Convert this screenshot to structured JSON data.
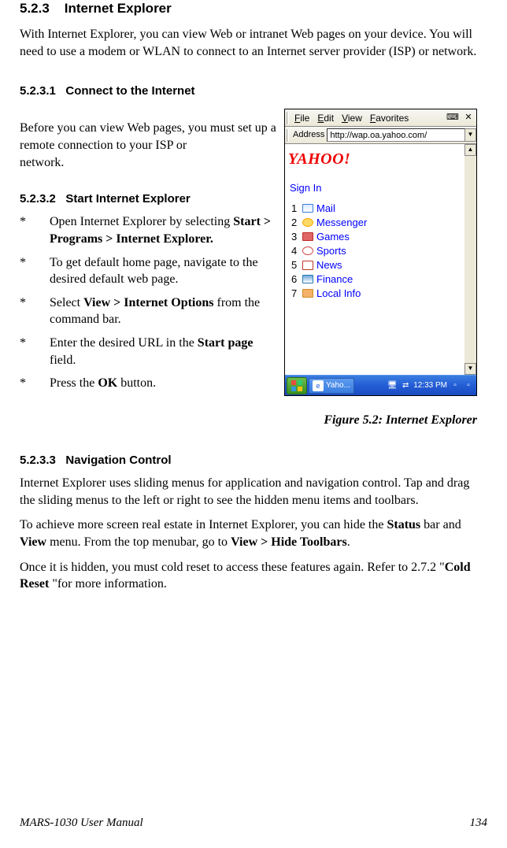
{
  "section": {
    "number": "5.2.3",
    "title": "Internet Explorer",
    "intro": "With Internet Explorer, you can view Web or intranet Web pages on your device. You will need to use a modem or WLAN to connect to an Internet server provider (ISP) or network."
  },
  "sub1": {
    "number": "5.2.3.1",
    "title": "Connect to the Internet",
    "body": "Before you can view Web pages, you must set up a remote connection to your ISP or",
    "body2": "network."
  },
  "sub2": {
    "number": "5.2.3.2",
    "title": "Start Internet Explorer",
    "items": [
      {
        "pre": "Open Internet Explorer by selecting ",
        "bold": "Start > Programs > Internet Explorer."
      },
      {
        "pre": "To get default home page, navigate to the desired default web page."
      },
      {
        "pre": "Select ",
        "bold": "View > Internet Options",
        "post": " from the command bar."
      },
      {
        "pre": "Enter the desired URL in the ",
        "bold": "Start page",
        "post": " field."
      },
      {
        "pre": "Press the ",
        "bold": "OK",
        "post": " button."
      }
    ]
  },
  "figure_caption": "Figure 5.2: Internet Explorer",
  "sub3": {
    "number": "5.2.3.3",
    "title": "Navigation Control",
    "p1": "Internet Explorer uses sliding menus for application and navigation control. Tap and drag the sliding menus to the left or right to see the hidden menu items and toolbars.",
    "p2_a": "To achieve more screen real estate in Internet Explorer, you can hide the ",
    "p2_b": "Status",
    "p2_c": " bar and ",
    "p2_d": "View",
    "p2_e": " menu. From the top menubar, go to ",
    "p2_f": "View > Hide Toolbars",
    "p2_g": ".",
    "p3_a": "Once it is hidden, you must cold reset to access these features again. Refer to 2.7.2 \"",
    "p3_b": "Cold Reset",
    "p3_c": " \"for more information."
  },
  "screenshot": {
    "menu": {
      "file": "File",
      "edit": "Edit",
      "view": "View",
      "favorites": "Favorites"
    },
    "address_label": "Address",
    "url": "http://wap.oa.yahoo.com/",
    "logo": "YAHOO!",
    "signin": "Sign In",
    "items": [
      {
        "n": "1",
        "label": "Mail",
        "color": "#3b7dd8"
      },
      {
        "n": "2",
        "label": "Messenger",
        "color": "#f7a800"
      },
      {
        "n": "3",
        "label": "Games",
        "color": "#c02a2a"
      },
      {
        "n": "4",
        "label": "Sports",
        "color": "#d04a4a"
      },
      {
        "n": "5",
        "label": "News",
        "color": "#c0392b"
      },
      {
        "n": "6",
        "label": "Finance",
        "color": "#2a7ab0"
      },
      {
        "n": "7",
        "label": "Local Info",
        "color": "#d08a2a"
      }
    ],
    "task_label": "Yaho...",
    "time": "12:33 PM"
  },
  "footer": {
    "title": "MARS-1030 User Manual",
    "page": "134"
  }
}
